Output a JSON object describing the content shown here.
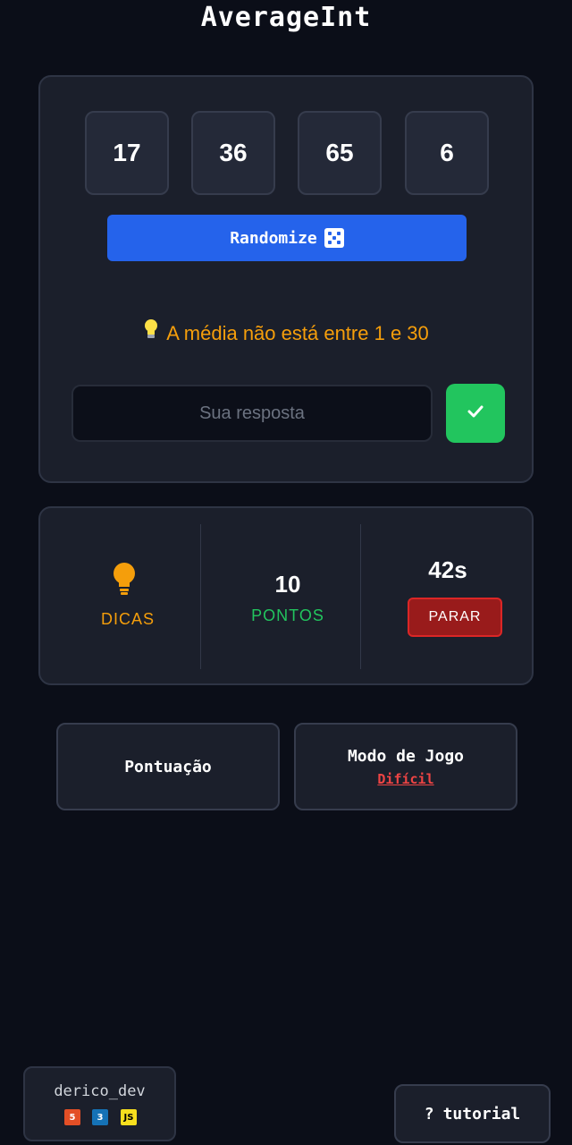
{
  "app": {
    "title": "AverageInt"
  },
  "game": {
    "numbers": [
      "17",
      "36",
      "65",
      "6"
    ],
    "randomize_label": "Randomize",
    "hint_text": "A média não está entre 1 e 30",
    "answer_placeholder": "Sua resposta",
    "answer_value": ""
  },
  "stats": {
    "hints_label": "DICAS",
    "points_value": "10",
    "points_label": "PONTOS",
    "timer_value": "42s",
    "stop_label": "PARAR"
  },
  "menu": {
    "score_label": "Pontuação",
    "mode_label": "Modo de Jogo",
    "mode_value": "Difícil"
  },
  "footer": {
    "credit": "derico_dev",
    "tech_badges": [
      {
        "icon": "html5-icon",
        "text": "5",
        "color": "#e34f26"
      },
      {
        "icon": "css3-icon",
        "text": "3",
        "color": "#1572b6"
      },
      {
        "icon": "js-icon",
        "text": "JS",
        "color": "#f7df1e"
      }
    ],
    "tutorial_label": "tutorial",
    "tutorial_icon": "?"
  },
  "colors": {
    "background": "#0b0e18",
    "panel": "#1b1f2b",
    "accent_blue": "#2563eb",
    "success_green": "#22c55e",
    "hint_amber": "#f59e0b",
    "danger_red": "#991b1b"
  },
  "icons": {
    "hint": "lightbulb-icon",
    "randomize": "dice-icon",
    "submit": "checkmark-icon"
  }
}
